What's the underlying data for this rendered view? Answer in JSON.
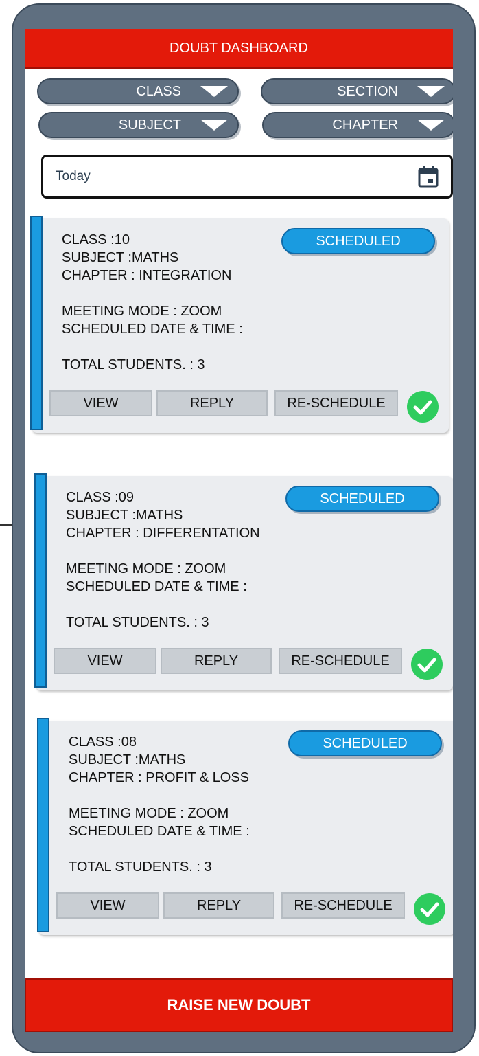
{
  "header": {
    "title": "DOUBT DASHBOARD"
  },
  "filters": {
    "class_label": "CLASS",
    "section_label": "SECTION",
    "subject_label": "SUBJECT",
    "chapter_label": "CHAPTER"
  },
  "date_filter": {
    "value": "Today",
    "icon": "calendar-icon"
  },
  "cards": [
    {
      "class": "CLASS :10",
      "subject": "SUBJECT :MATHS",
      "chapter": "CHAPTER : INTEGRATION",
      "meeting_mode": "MEETING MODE : ZOOM",
      "scheduled": "SCHEDULED DATE & TIME :",
      "students": "TOTAL STUDENTS. : 3",
      "status": "SCHEDULED",
      "view_label": "VIEW",
      "reply_label": "REPLY",
      "reschedule_label": "RE-SCHEDULE"
    },
    {
      "class": "CLASS :09",
      "subject": "SUBJECT :MATHS",
      "chapter": "CHAPTER : DIFFERENTATION",
      "meeting_mode": "MEETING MODE : ZOOM",
      "scheduled": "SCHEDULED DATE & TIME :",
      "students": "TOTAL STUDENTS. : 3",
      "status": "SCHEDULED",
      "view_label": "VIEW",
      "reply_label": "REPLY",
      "reschedule_label": "RE-SCHEDULE"
    },
    {
      "class": "CLASS :08",
      "subject": "SUBJECT :MATHS",
      "chapter": "CHAPTER : PROFIT & LOSS",
      "meeting_mode": "MEETING MODE : ZOOM",
      "scheduled": "SCHEDULED DATE & TIME :",
      "students": "TOTAL STUDENTS. : 3",
      "status": "SCHEDULED",
      "view_label": "VIEW",
      "reply_label": "REPLY",
      "reschedule_label": "RE-SCHEDULE"
    }
  ],
  "footer": {
    "raise_label": "RAISE NEW DOUBT"
  },
  "colors": {
    "header_red": "#e31a0a",
    "accent_blue": "#1a9be0",
    "dropdown_slate": "#5f6f80",
    "success_green": "#2ecc5e"
  }
}
